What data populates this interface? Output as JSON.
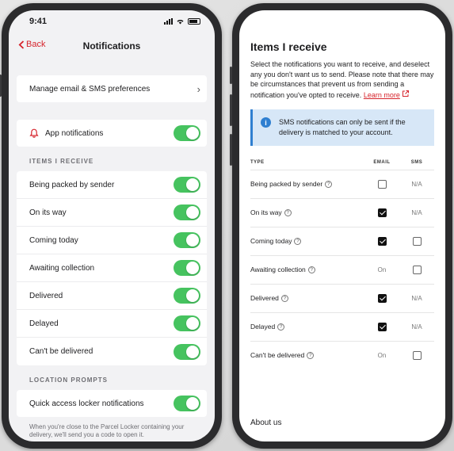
{
  "status_bar": {
    "time": "9:41"
  },
  "left": {
    "back_label": "Back",
    "title": "Notifications",
    "manage_prefs": "Manage email & SMS preferences",
    "app_notifications": "App notifications",
    "section_items": "ITEMS I RECEIVE",
    "items": [
      {
        "label": "Being packed by sender",
        "on": true
      },
      {
        "label": "On its way",
        "on": true
      },
      {
        "label": "Coming today",
        "on": true
      },
      {
        "label": "Awaiting collection",
        "on": true
      },
      {
        "label": "Delivered",
        "on": true
      },
      {
        "label": "Delayed",
        "on": true
      },
      {
        "label": "Can't be delivered",
        "on": true
      }
    ],
    "section_location": "LOCATION PROMPTS",
    "locker_label": "Quick access locker notifications",
    "footer": "When you're close to the Parcel Locker containing your delivery, we'll send you a code to open it."
  },
  "right": {
    "title": "Items I receive",
    "description": "Select the notifications you want to receive, and deselect any you don't want us to send. Please note that there may be circumstances that prevent us from sending a notification you've opted to receive.",
    "learn_more": "Learn more",
    "info": "SMS notifications can only be sent if the delivery is matched to your account.",
    "col_type": "TYPE",
    "col_email": "EMAIL",
    "col_sms": "SMS",
    "rows": [
      {
        "label": "Being packed by sender",
        "email": "unchecked",
        "sms": "N/A"
      },
      {
        "label": "On its way",
        "email": "checked",
        "sms": "N/A"
      },
      {
        "label": "Coming today",
        "email": "checked",
        "sms": "unchecked"
      },
      {
        "label": "Awaiting collection",
        "email": "On",
        "sms": "unchecked"
      },
      {
        "label": "Delivered",
        "email": "checked",
        "sms": "N/A"
      },
      {
        "label": "Delayed",
        "email": "checked",
        "sms": "N/A"
      },
      {
        "label": "Can't be delivered",
        "email": "On",
        "sms": "unchecked"
      }
    ],
    "about": "About us"
  },
  "colors": {
    "accent": "#d6232b",
    "toggle_on": "#46c35f",
    "info_bg": "#d7e7f7",
    "info_icon": "#2f7fd0"
  },
  "icons": [
    "chevron-left-icon",
    "bell-icon",
    "chevron-right-icon",
    "info-icon",
    "external-link-icon",
    "help-icon"
  ]
}
